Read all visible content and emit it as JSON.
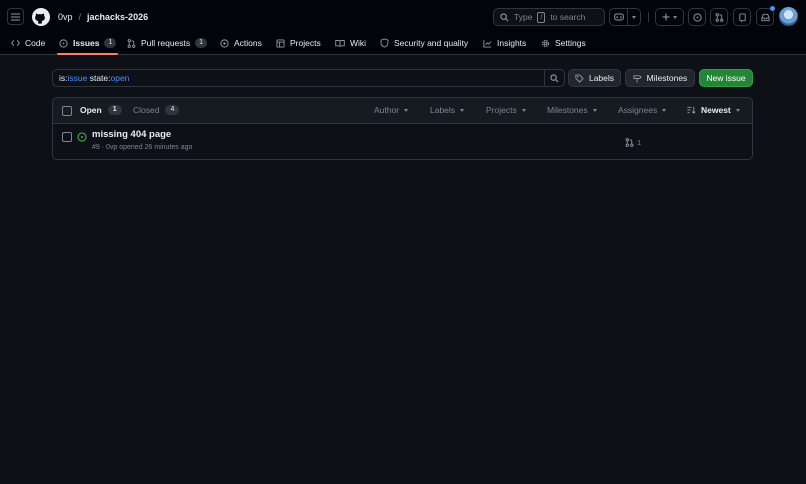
{
  "header": {
    "owner": "0vp",
    "separator": "/",
    "repo": "jachacks-2026",
    "search_prefix": "Type",
    "search_key": "/",
    "search_suffix": "to search"
  },
  "tabs": [
    {
      "label": "Code",
      "icon": "code-icon"
    },
    {
      "label": "Issues",
      "count": "1",
      "icon": "issue-opened-icon",
      "active": true
    },
    {
      "label": "Pull requests",
      "count": "1",
      "icon": "git-pull-request-icon"
    },
    {
      "label": "Actions",
      "icon": "play-icon"
    },
    {
      "label": "Projects",
      "icon": "table-icon"
    },
    {
      "label": "Wiki",
      "icon": "book-icon"
    },
    {
      "label": "Security and quality",
      "icon": "shield-icon"
    },
    {
      "label": "Insights",
      "icon": "graph-icon"
    },
    {
      "label": "Settings",
      "icon": "gear-icon"
    }
  ],
  "filter": {
    "q1_key": "is:",
    "q1_val": "issue",
    "q2_key": " state:",
    "q2_val": "open"
  },
  "actions": {
    "labels": "Labels",
    "milestones": "Milestones",
    "new_issue": "New issue"
  },
  "list": {
    "open_label": "Open",
    "open_count": "1",
    "closed_label": "Closed",
    "closed_count": "4",
    "filters": [
      "Author",
      "Labels",
      "Projects",
      "Milestones",
      "Assignees",
      "Newest"
    ]
  },
  "issues": [
    {
      "title": "missing 404 page",
      "meta": "#9 · 0vp opened 26 minutes ago",
      "linked_prs": "1"
    }
  ],
  "colors": {
    "bg": "#0d1117",
    "header_bg": "#010409",
    "accent_underline": "#f78166",
    "open_green": "#3fb950",
    "primary_button": "#238636",
    "link_blue": "#4493f8"
  }
}
